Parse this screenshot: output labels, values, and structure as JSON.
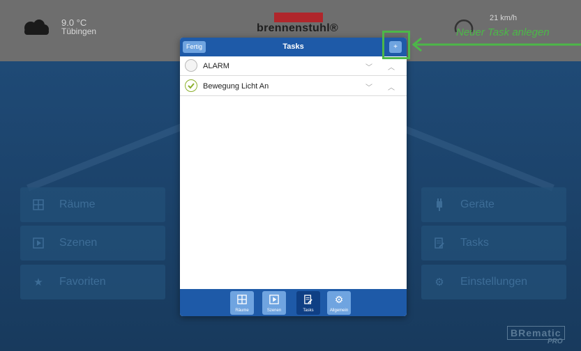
{
  "weather": {
    "temperature": "9.0 °C",
    "location": "Tübingen"
  },
  "brand": "brennenstuhl®",
  "wind": {
    "speed": "21 km/h"
  },
  "tiles_left": [
    {
      "icon": "rooms-icon",
      "label": "Räume"
    },
    {
      "icon": "scenes-icon",
      "label": "Szenen"
    },
    {
      "icon": "star-icon",
      "label": "Favoriten"
    }
  ],
  "tiles_right": [
    {
      "icon": "plug-icon",
      "label": "Geräte"
    },
    {
      "icon": "tasks-icon",
      "label": "Tasks"
    },
    {
      "icon": "gears-icon",
      "label": "Einstellungen"
    }
  ],
  "logo": {
    "word": "BRematic",
    "pro": "PRO"
  },
  "modal": {
    "title": "Tasks",
    "done_label": "Fertig",
    "add_label": "+",
    "tasks": [
      {
        "label": "ALARM",
        "checked": false
      },
      {
        "label": "Bewegung Licht An",
        "checked": true
      }
    ],
    "footer": [
      {
        "icon": "rooms-icon",
        "label": "Räume",
        "active": false
      },
      {
        "icon": "scenes-icon",
        "label": "Szenen",
        "active": false
      },
      {
        "icon": "tasks-icon",
        "label": "Tasks",
        "active": true
      },
      {
        "icon": "gears-icon",
        "label": "Allgemein",
        "active": false
      }
    ]
  },
  "annotation": {
    "text": "Neuer Task anlegen",
    "color": "#4cb848"
  },
  "colors": {
    "header_blue": "#1e5aa8",
    "button_blue": "#6fa4e0",
    "active_blue": "#0f3f84",
    "check_green": "#8aae2a"
  }
}
